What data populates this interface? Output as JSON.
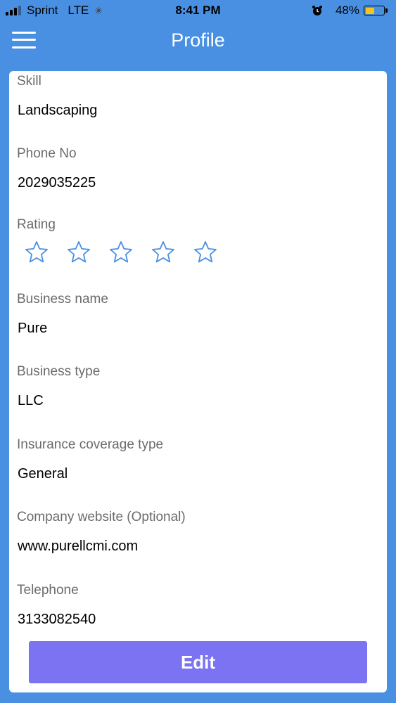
{
  "status_bar": {
    "carrier": "Sprint",
    "network": "LTE",
    "time": "8:41 PM",
    "battery_percent": "48%",
    "battery_level": 0.48,
    "battery_color": "#f5c518"
  },
  "nav": {
    "title": "Profile",
    "menu_icon": "hamburger-menu-icon"
  },
  "profile": {
    "skill": {
      "label": "Skill",
      "value": "Landscaping"
    },
    "phone": {
      "label": "Phone No",
      "value": "2029035225"
    },
    "rating": {
      "label": "Rating",
      "stars_total": 5,
      "stars_filled": 0,
      "star_color": "#4a90e2"
    },
    "business_name": {
      "label": "Business name",
      "value": "Pure"
    },
    "business_type": {
      "label": "Business type",
      "value": "LLC"
    },
    "insurance": {
      "label": "Insurance coverage type",
      "value": "General"
    },
    "website": {
      "label": "Company website (Optional)",
      "value": "www.purellcmi.com"
    },
    "telephone": {
      "label": "Telephone",
      "value": "3133082540"
    }
  },
  "actions": {
    "edit_label": "Edit"
  },
  "colors": {
    "background": "#4a90e2",
    "card": "#ffffff",
    "edit_button": "#7b73f2"
  }
}
